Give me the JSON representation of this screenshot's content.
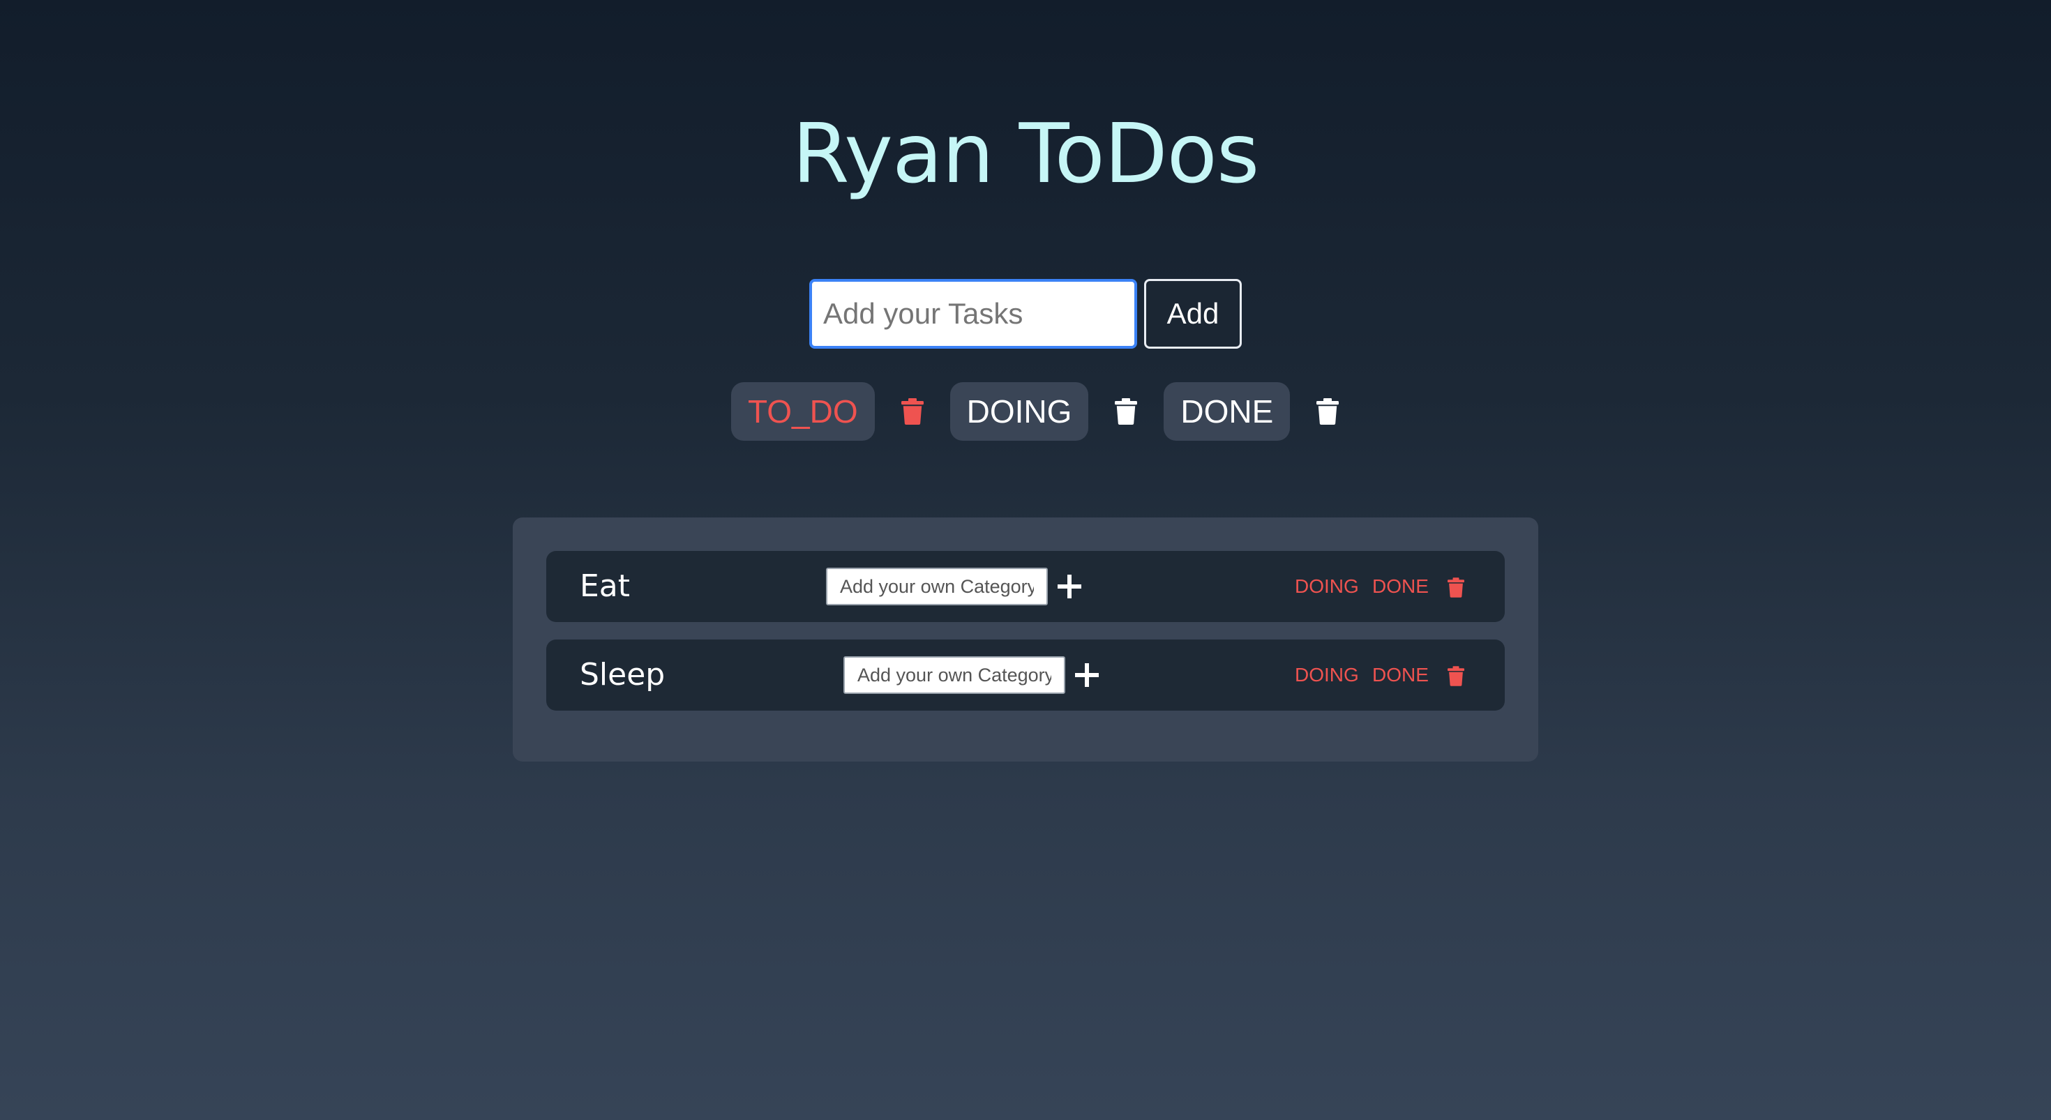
{
  "app": {
    "title": "Ryan ToDos"
  },
  "task_form": {
    "placeholder": "Add your Tasks",
    "value": "",
    "add_label": "Add"
  },
  "categories": [
    {
      "label": "TO_DO",
      "active": true,
      "trash_icon": "trash-icon",
      "trash_color": "#ef5350"
    },
    {
      "label": "DOING",
      "active": false,
      "trash_icon": "trash-icon",
      "trash_color": "#ffffff"
    },
    {
      "label": "DONE",
      "active": false,
      "trash_icon": "trash-icon",
      "trash_color": "#ffffff"
    }
  ],
  "tasks": [
    {
      "name": "Eat",
      "category_placeholder": "Add your own Category",
      "add_icon": "plus-icon",
      "actions": [
        "DOING",
        "DONE"
      ],
      "delete_icon": "trash-icon"
    },
    {
      "name": "Sleep",
      "category_placeholder": "Add your own Category",
      "add_icon": "plus-icon",
      "actions": [
        "DOING",
        "DONE"
      ],
      "delete_icon": "trash-icon"
    }
  ],
  "colors": {
    "title": "#c6f6f6",
    "accent_red": "#ef5350",
    "panel": "#3a4556",
    "row": "#1e2935",
    "focus_ring": "#3b82f6"
  }
}
